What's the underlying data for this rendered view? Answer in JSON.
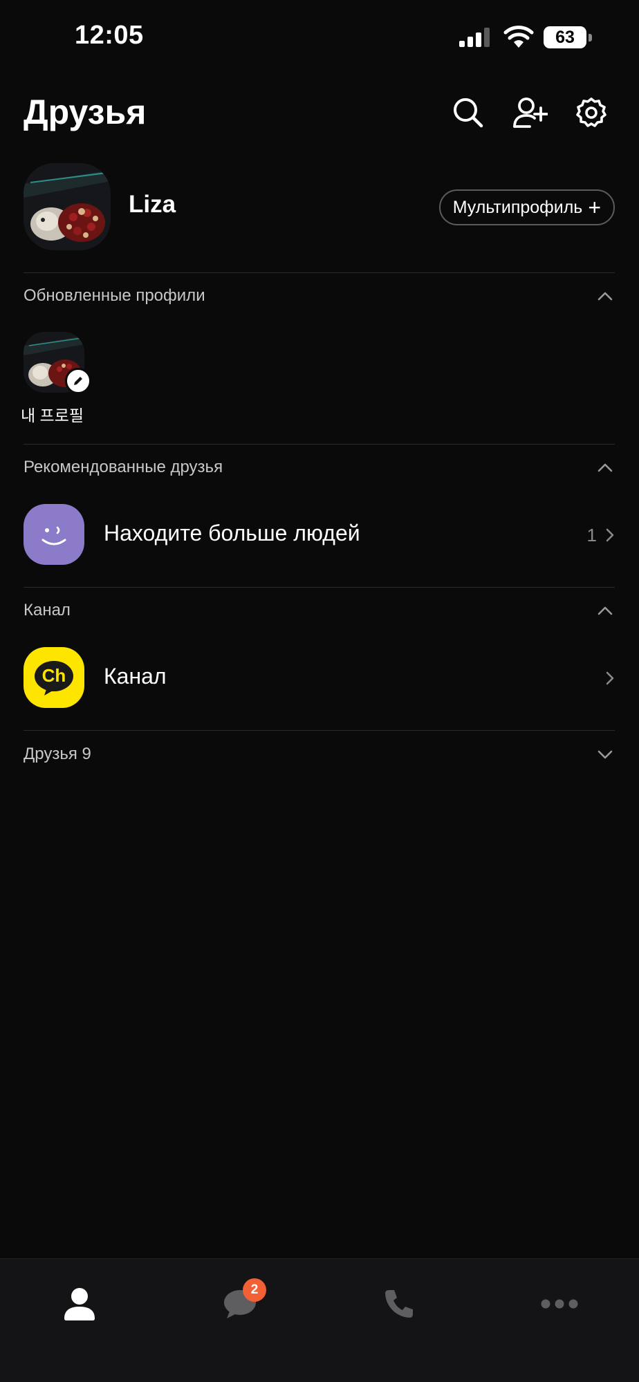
{
  "status_bar": {
    "time": "12:05",
    "battery": "63"
  },
  "header": {
    "title": "Друзья",
    "icons": [
      "search-icon",
      "add-friend-icon",
      "settings-icon"
    ]
  },
  "my_profile": {
    "name": "Liza",
    "multiprofile_label": "Мультипрофиль",
    "multiprofile_icon": "+"
  },
  "sections": {
    "updated_profiles": {
      "title": "Обновленные профили",
      "expanded": true,
      "items": [
        {
          "label": "내 프로필",
          "badge_icon": "pencil-icon"
        }
      ]
    },
    "recommended": {
      "title": "Рекомендованные друзья",
      "expanded": true,
      "row": {
        "label": "Находите больше людей",
        "count": "1",
        "icon": "smiley-icon"
      }
    },
    "channel": {
      "title": "Канал",
      "expanded": true,
      "row": {
        "label": "Канал",
        "icon": "channel-ch-icon",
        "icon_text": "Ch"
      }
    },
    "friends": {
      "title": "Друзья 9",
      "expanded": false
    }
  },
  "tab_bar": {
    "tabs": [
      {
        "name": "friends-tab",
        "icon": "person-icon",
        "active": true
      },
      {
        "name": "chats-tab",
        "icon": "chat-bubble-icon",
        "badge": "2"
      },
      {
        "name": "calls-tab",
        "icon": "phone-icon"
      },
      {
        "name": "more-tab",
        "icon": "more-dots-icon"
      }
    ]
  },
  "colors": {
    "background": "#0a0a0b",
    "tab_bar": "#141416",
    "recommend_icon_bg": "#8b7bc8",
    "channel_icon_bg": "#fee500",
    "badge": "#f26135"
  }
}
